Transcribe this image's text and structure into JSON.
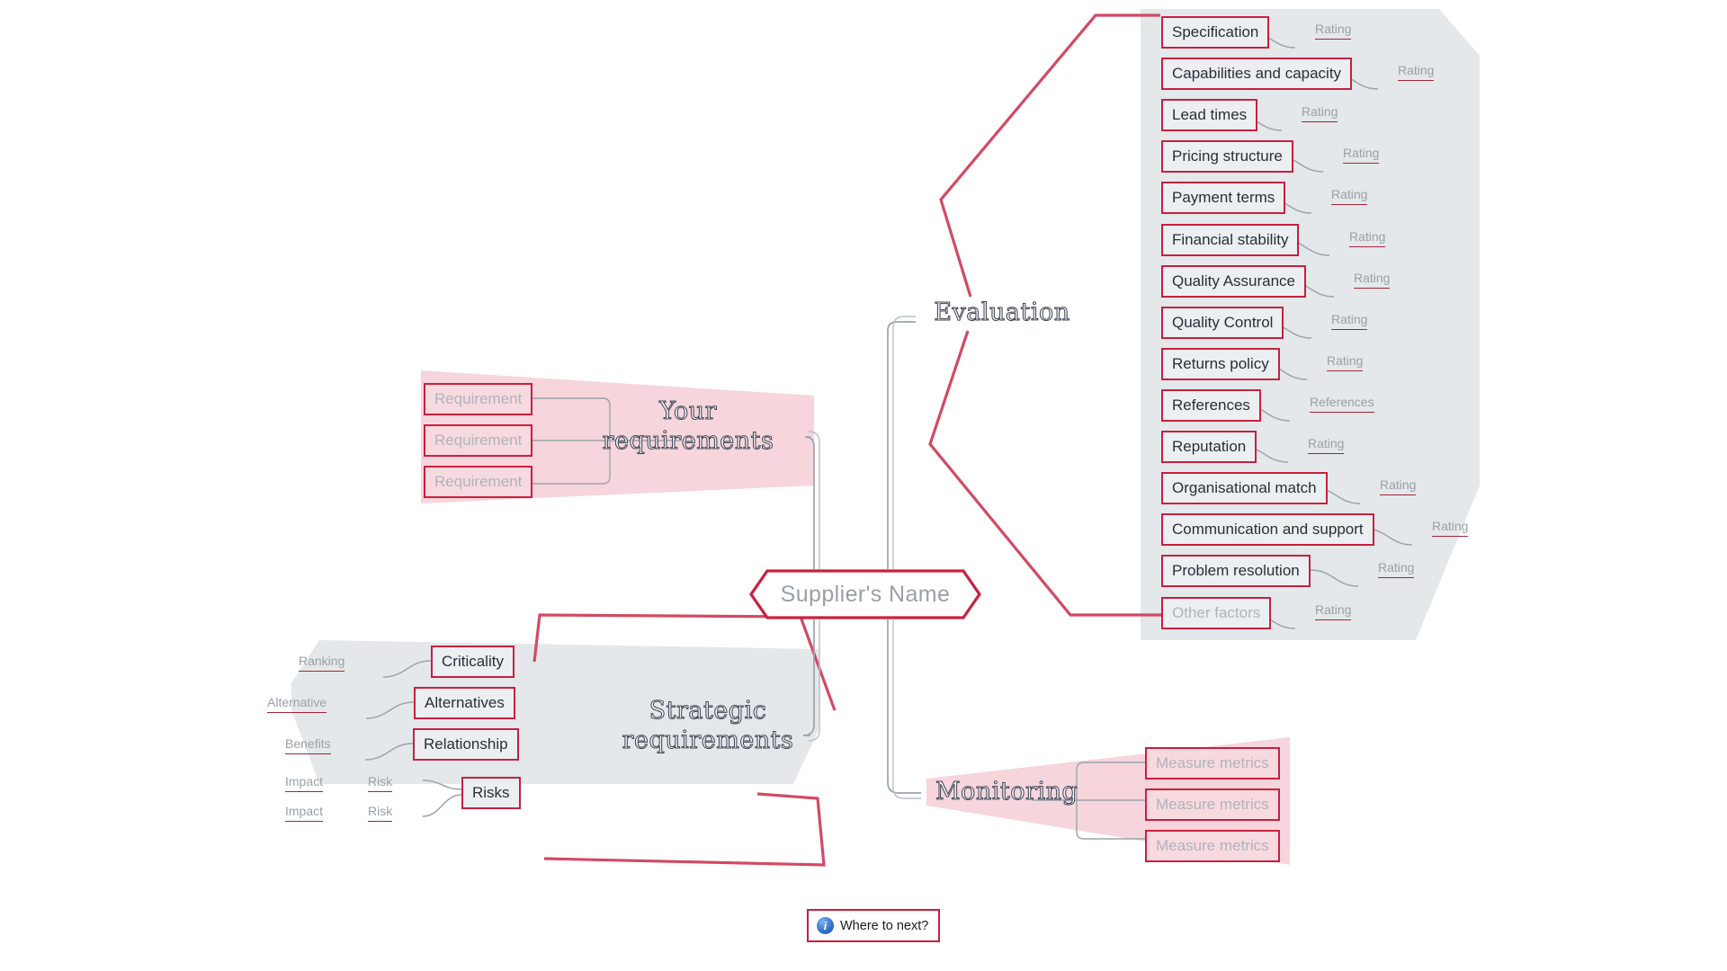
{
  "title": "Supplier selection mind map",
  "colors": {
    "accent_red": "#c8203f",
    "leaf_underline": "#a32437",
    "grey_branch_fill": "#e4e8ea",
    "pink_branch_fill": "#f7d5dc",
    "connector_grey": "#9aa4ad",
    "ghost_text": "#b0b4ba",
    "node_text": "#2a2f38",
    "info_blue": "#2d71c9"
  },
  "central": {
    "label": "Supplier's Name",
    "is_placeholder": true
  },
  "footer": {
    "where_next_label": "Where to next?",
    "info_icon": "info-icon"
  },
  "branches": [
    {
      "id": "evaluation",
      "title": "Evaluation",
      "fill": "grey",
      "side": "right",
      "items": [
        {
          "label": "Specification",
          "leaf": "Rating",
          "ghost": false
        },
        {
          "label": "Capabilities and capacity",
          "leaf": "Rating",
          "ghost": false
        },
        {
          "label": "Lead times",
          "leaf": "Rating",
          "ghost": false
        },
        {
          "label": "Pricing structure",
          "leaf": "Rating",
          "ghost": false
        },
        {
          "label": "Payment terms",
          "leaf": "Rating",
          "ghost": false
        },
        {
          "label": "Financial stability",
          "leaf": "Rating",
          "ghost": false
        },
        {
          "label": "Quality Assurance",
          "leaf": "Rating",
          "ghost": false
        },
        {
          "label": "Quality Control",
          "leaf": "Rating",
          "ghost": false
        },
        {
          "label": "Returns policy",
          "leaf": "Rating",
          "ghost": false
        },
        {
          "label": "References",
          "leaf": "References",
          "ghost": false
        },
        {
          "label": "Reputation",
          "leaf": "Rating",
          "ghost": false
        },
        {
          "label": "Organisational match",
          "leaf": "Rating",
          "ghost": false
        },
        {
          "label": "Communication and support",
          "leaf": "Rating",
          "ghost": false
        },
        {
          "label": "Problem resolution",
          "leaf": "Rating",
          "ghost": false
        },
        {
          "label": "Other factors",
          "leaf": "Rating",
          "ghost": true
        }
      ]
    },
    {
      "id": "your-requirements",
      "title": "Your\nrequirements",
      "fill": "pink",
      "side": "left",
      "items": [
        {
          "label": "Requirement",
          "ghost": true
        },
        {
          "label": "Requirement",
          "ghost": true
        },
        {
          "label": "Requirement",
          "ghost": true
        }
      ]
    },
    {
      "id": "strategic-requirements",
      "title": "Strategic\nrequirements",
      "fill": "grey",
      "side": "left",
      "items": [
        {
          "label": "Criticality",
          "leaf": "Ranking",
          "ghost": false
        },
        {
          "label": "Alternatives",
          "leaf": "Alternative",
          "ghost": false
        },
        {
          "label": "Relationship",
          "leaf": "Benefits",
          "ghost": false
        },
        {
          "label": "Risks",
          "ghost": false,
          "sub": [
            {
              "leaf": "Risk",
              "leaf2": "Impact"
            },
            {
              "leaf": "Risk",
              "leaf2": "Impact"
            }
          ]
        }
      ]
    },
    {
      "id": "monitoring",
      "title": "Monitoring",
      "fill": "pink",
      "side": "right",
      "items": [
        {
          "label": "Measure metrics",
          "ghost": true
        },
        {
          "label": "Measure metrics",
          "ghost": true
        },
        {
          "label": "Measure metrics",
          "ghost": true
        }
      ]
    }
  ]
}
